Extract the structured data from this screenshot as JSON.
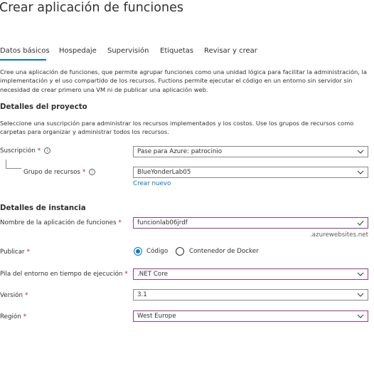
{
  "title": "Crear aplicación de funciones",
  "tabs": [
    "Datos básicos",
    "Hospedaje",
    "Supervisión",
    "Etiquetas",
    "Revisar y crear"
  ],
  "intro": "Cree una aplicación de funciones, que permite agrupar funciones como una unidad lógica para facilitar la administración, la implementación y el uso compartido de los recursos. Fuctions permite ejecutar el código en un entorno sin servidor sin necesidad de crear primero una VM ni de publicar una aplicación web.",
  "project": {
    "heading": "Detalles del proyecto",
    "description": "Seleccione una suscripción para administrar los recursos implementados y los costos. Use los grupos de recursos como carpetas para organizar y administrar todos los recursos.",
    "subscription_label": "Suscripción",
    "subscription_value": "Pase para Azure: patrocinio",
    "resource_group_label": "Grupo de recursos",
    "resource_group_value": "BlueYonderLab05",
    "create_new_link": "Crear nuevo"
  },
  "instance": {
    "heading": "Detalles de instancia",
    "app_name_label": "Nombre de la aplicación de funciones",
    "app_name_value": "funcionlab06jrdf",
    "domain_suffix": ".azurewebsites.net",
    "publish_label": "Publicar",
    "publish_options": [
      "Código",
      "Contenedor de Docker"
    ],
    "publish_selected": "Código",
    "runtime_label": "Pila del entorno en tiempo de ejecución",
    "runtime_value": ".NET Core",
    "version_label": "Versión",
    "version_value": "3.1",
    "region_label": "Región",
    "region_value": "West Europe"
  },
  "required_marker": "*",
  "info_glyph": "i",
  "colors": {
    "accent": "#0078d4",
    "required": "#a4262c",
    "focus_border": "#8e3f8e",
    "valid": "#107c10"
  }
}
